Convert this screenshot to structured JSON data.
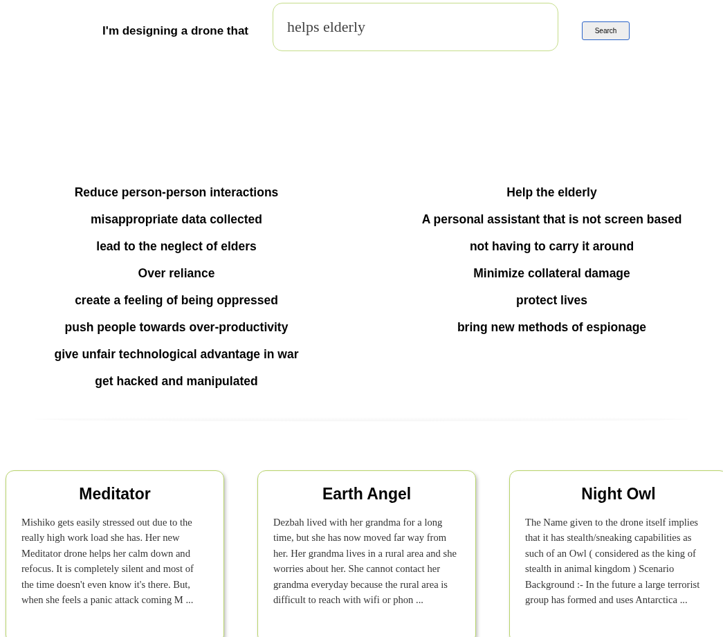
{
  "prompt": {
    "label": "I'm designing a drone that",
    "value": "helps elderly",
    "button": "Search"
  },
  "columns": [
    {
      "items": [
        "Reduce person-person interactions",
        "misappropriate data collected",
        "lead to the neglect of elders",
        "Over reliance",
        "create a feeling of being oppressed",
        "push people towards over-productivity",
        "give unfair technological advantage in war",
        "get hacked and manipulated"
      ]
    },
    {
      "items": [
        "Help the elderly",
        "A personal assistant that is not screen based",
        "not having to carry it around",
        "Minimize collateral damage",
        "protect lives",
        "bring new methods of espionage"
      ]
    }
  ],
  "cards": [
    {
      "title": "Meditator",
      "text": "Mishiko gets easily stressed out due to the really high work load she has. Her new Meditator drone helps her calm down and refocus. It is completely silent and most of the time doesn't even know it's there. But, when she feels a panic attack coming M ..."
    },
    {
      "title": "Earth Angel",
      "text": "Dezbah lived with her grandma for a long time, but she has now moved far way from her. Her grandma lives in a rural area and she worries about her. She cannot contact her grandma everyday because the rural area is difficult to reach with wifi or phon ..."
    },
    {
      "title": "Night Owl",
      "text": "The Name given to the drone itself implies that it has stealth/sneaking capabilities as such of an Owl ( considered as the king of stealth in animal kingdom ) Scenario Background :- In the future a large terrorist group has formed and uses Antarctica ..."
    }
  ]
}
